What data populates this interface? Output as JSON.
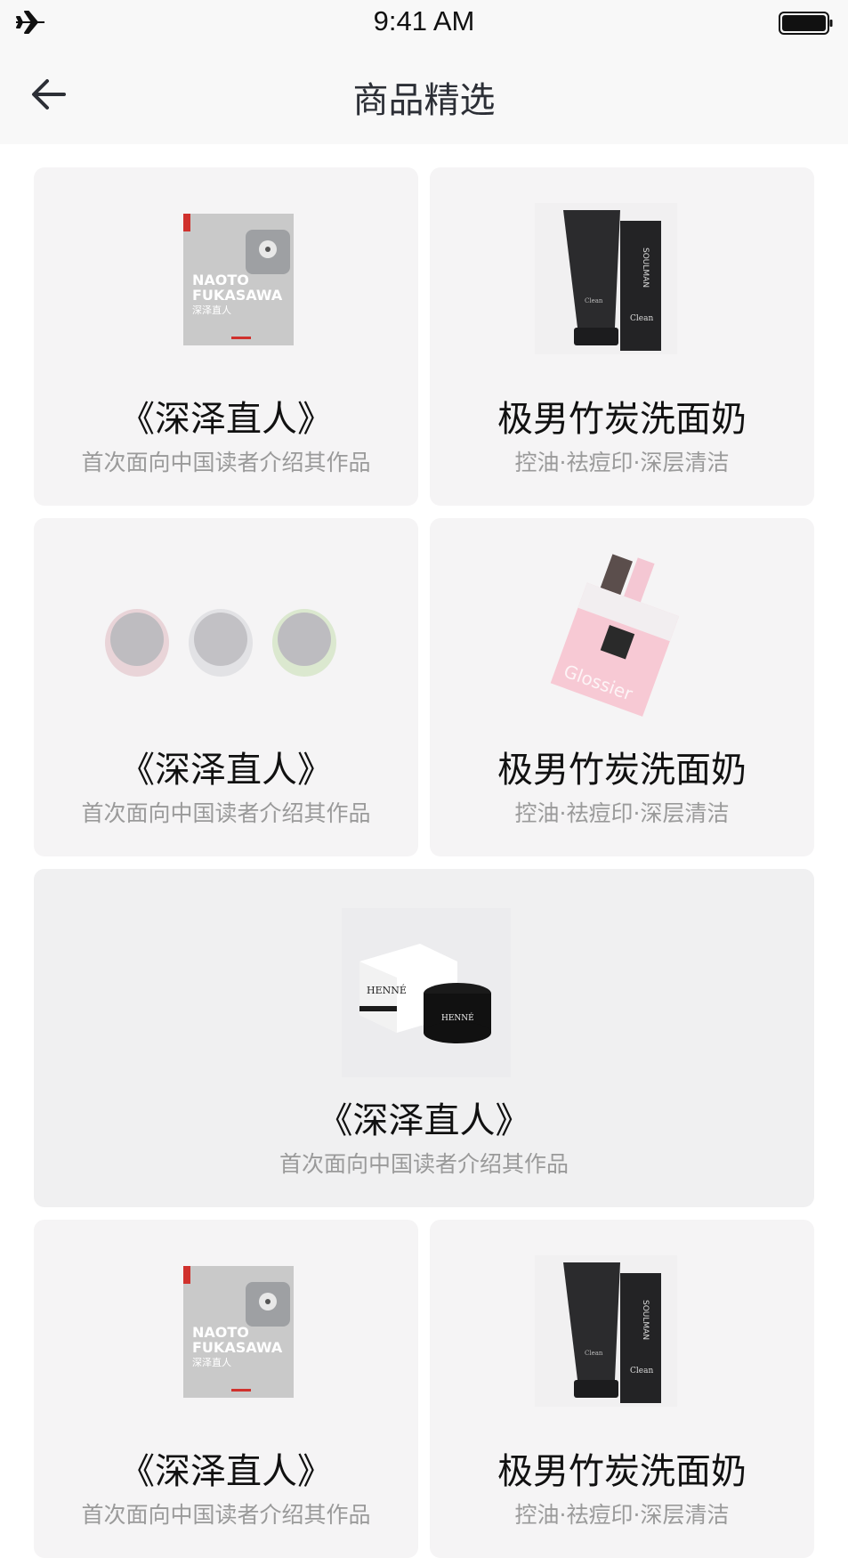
{
  "status": {
    "time": "9:41 AM"
  },
  "nav": {
    "title": "商品精选"
  },
  "products": [
    {
      "title": "《深泽直人》",
      "subtitle": "首次面向中国读者介绍其作品",
      "image": "book-cover",
      "book_lines": [
        "NAOTO",
        "FUKASAWA"
      ],
      "book_cn": "深泽直人"
    },
    {
      "title": "极男竹炭洗面奶",
      "subtitle": "控油·祛痘印·深层清洁",
      "image": "cleanser-tube",
      "box_brand": "SOULMAN",
      "box_word": "Clean"
    },
    {
      "title": "《深泽直人》",
      "subtitle": "首次面向中国读者介绍其作品",
      "image": "three-jars"
    },
    {
      "title": "极男竹炭洗面奶",
      "subtitle": "控油·祛痘印·深层清洁",
      "image": "pink-package",
      "pkg_text": "Glossier"
    },
    {
      "title": "《深泽直人》",
      "subtitle": "首次面向中国读者介绍其作品",
      "image": "henne-jar",
      "brand": "HENNÉ"
    },
    {
      "title": "《深泽直人》",
      "subtitle": "首次面向中国读者介绍其作品",
      "image": "book-cover",
      "book_lines": [
        "NAOTO",
        "FUKASAWA"
      ],
      "book_cn": "深泽直人"
    },
    {
      "title": "极男竹炭洗面奶",
      "subtitle": "控油·祛痘印·深层清洁",
      "image": "cleanser-tube",
      "box_brand": "SOULMAN",
      "box_word": "Clean"
    }
  ]
}
